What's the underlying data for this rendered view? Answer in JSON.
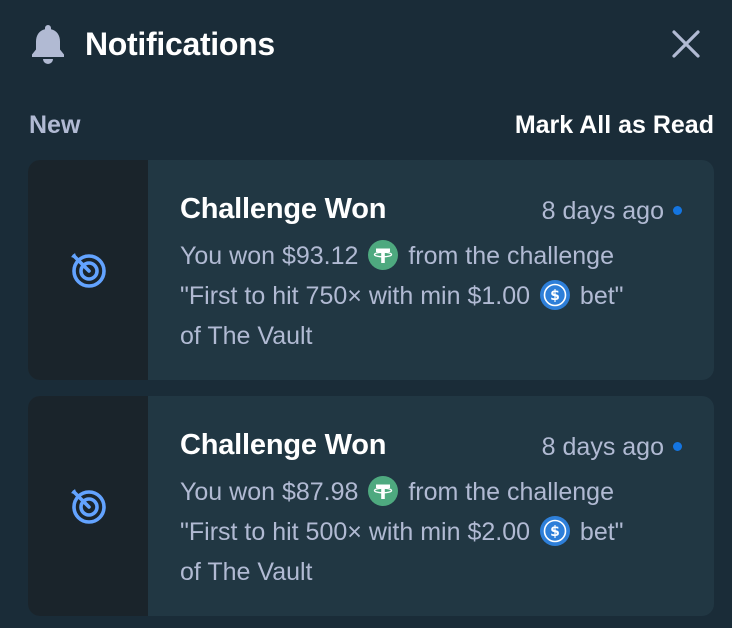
{
  "header": {
    "title": "Notifications",
    "bell_icon": "bell-icon",
    "close_icon": "close-icon"
  },
  "section": {
    "label": "New",
    "mark_all": "Mark All as Read"
  },
  "colors": {
    "background": "#1a2c38",
    "card": "#213743",
    "icon_column": "#1a242b",
    "accent_blue": "#1475e1",
    "icon_blue": "#63a3ff",
    "tether_green": "#4ea97f",
    "usdc_blue": "#2e7fd9",
    "muted_text": "#b1bad3"
  },
  "notifications": [
    {
      "icon": "target-icon",
      "title": "Challenge Won",
      "time": "8 days ago",
      "unread": true,
      "line1_prefix": "You won $93.12",
      "line1_coin": "tether-icon",
      "line1_suffix": "from the challenge",
      "line2_prefix": "\"First to hit 750× with min $1.00",
      "line2_coin": "usdc-icon",
      "line2_suffix": "bet\"",
      "line3": "of The Vault"
    },
    {
      "icon": "target-icon",
      "title": "Challenge Won",
      "time": "8 days ago",
      "unread": true,
      "line1_prefix": "You won $87.98",
      "line1_coin": "tether-icon",
      "line1_suffix": "from the challenge",
      "line2_prefix": "\"First to hit 500× with min $2.00",
      "line2_coin": "usdc-icon",
      "line2_suffix": "bet\"",
      "line3": "of The Vault"
    }
  ]
}
